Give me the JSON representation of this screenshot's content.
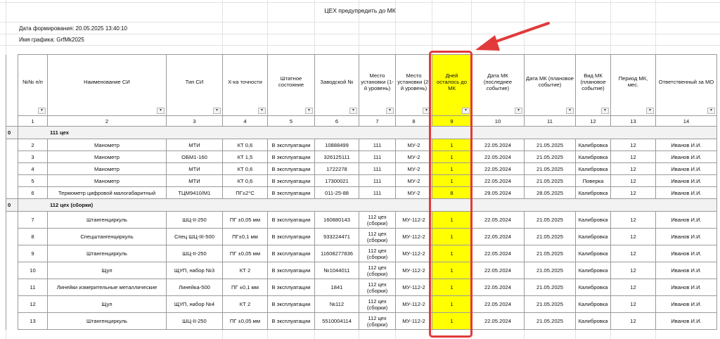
{
  "title": "ЦЕХ предупредить до МК",
  "date_label": "Дата формирования: 20.05.2025 13:40:10",
  "schedule_label": "Имя графика: GrfMk2025",
  "columns": [
    "№№ п/п",
    "Наименование СИ",
    "Тип СИ",
    "Х-ка точности",
    "Штатное состояние",
    "Заводской №",
    "Место установки (1-й уровень)",
    "Место установки (2-й уровень)",
    "Дней осталось до МК",
    "Дата МК (последнее событие)",
    "Дата МК (плановое событие)",
    "Вид МК (плановое событие)",
    "Период МК, мес.",
    "Ответственный за МО"
  ],
  "column_numbers": [
    "1",
    "2",
    "3",
    "4",
    "5",
    "6",
    "7",
    "8",
    "9",
    "10",
    "11",
    "12",
    "13",
    "14"
  ],
  "groups": [
    {
      "level": "0",
      "name": "111 цех",
      "rows": [
        [
          "2",
          "Манометр",
          "МТИ",
          "КТ 0,6",
          "В эксплуатации",
          "10888499",
          "111",
          "МУ-2",
          "1",
          "22.05.2024",
          "21.05.2025",
          "Калибровка",
          "12",
          "Иванов И.И."
        ],
        [
          "3",
          "Манометр",
          "ОБМ1-160",
          "КТ 1,5",
          "В эксплуатации",
          "326125111",
          "111",
          "МУ-2",
          "1",
          "22.05.2024",
          "21.05.2025",
          "Калибровка",
          "12",
          "Иванов И.И."
        ],
        [
          "4",
          "Манометр",
          "МТИ",
          "КТ 0,6",
          "В эксплуатации",
          "1722278",
          "111",
          "МУ-2",
          "1",
          "22.05.2024",
          "21.05.2025",
          "Калибровка",
          "12",
          "Иванов И.И."
        ],
        [
          "5",
          "Манометр",
          "МТИ",
          "КТ 0,6",
          "В эксплуатации",
          "17300021",
          "111",
          "МУ-2",
          "1",
          "22.05.2024",
          "21.05.2025",
          "Поверка",
          "12",
          "Иванов И.И."
        ],
        [
          "6",
          "Термометр цифровой малогабаритный",
          "ТЦМ9410/М1",
          "ПГ±2°С",
          "В эксплуатации",
          "011-25-88",
          "111",
          "МУ-2",
          "8",
          "29.05.2024",
          "28.05.2025",
          "Калибровка",
          "12",
          "Иванов И.И."
        ]
      ]
    },
    {
      "level": "0",
      "name": "112 цех (сборки)",
      "rows": [
        [
          "7",
          "Штангенциркуль",
          "ШЦ-II-250",
          "ПГ ±0,05 мм",
          "В эксплуатации",
          "160880143",
          "112 цех (сборки)",
          "МУ-112-2",
          "1",
          "22.05.2024",
          "21.05.2025",
          "Калибровка",
          "12",
          "Иванов И.И."
        ],
        [
          "8",
          "Спецштангенциркуль",
          "Спец ШЦ-III-500",
          "ПГ±0,1 мм",
          "В эксплуатации",
          "933224471",
          "112 цех (сборки)",
          "МУ-112-2",
          "1",
          "22.05.2024",
          "21.05.2025",
          "Калибровка",
          "12",
          "Иванов И.И."
        ],
        [
          "9",
          "Штангенциркуль",
          "ШЦ-II-250",
          "ПГ ±0,05 мм",
          "В эксплуатации",
          "11608277836",
          "112 цех (сборки)",
          "МУ-112-2",
          "1",
          "22.05.2024",
          "21.05.2025",
          "Калибровка",
          "12",
          "Иванов И.И."
        ],
        [
          "10",
          "Щуп",
          "ЩУП, набор №3",
          "КТ 2",
          "В эксплуатации",
          "№1044011",
          "112 цех (сборки)",
          "МУ-112-2",
          "1",
          "22.05.2024",
          "21.05.2025",
          "Калибровка",
          "12",
          "Иванов И.И."
        ],
        [
          "11",
          "Линейки измерительные металлические",
          "Линейка-500",
          "ПГ ±0,1 мм",
          "В эксплуатации",
          "1841",
          "112 цех (сборки)",
          "МУ-112-2",
          "1",
          "22.05.2024",
          "21.05.2025",
          "Калибровка",
          "12",
          "Иванов И.И."
        ],
        [
          "12",
          "Щуп",
          "ЩУП, набор №4",
          "КТ 2",
          "В эксплуатации",
          "№112",
          "112 цех (сборки)",
          "МУ-112-2",
          "1",
          "22.05.2024",
          "21.05.2025",
          "Калибровка",
          "12",
          "Иванов И.И."
        ],
        [
          "13",
          "Штангенциркуль",
          "ШЦ-II-250",
          "ПГ ±0,05 мм",
          "В эксплуатации",
          "5510004114",
          "112 цех (сборки)",
          "МУ-112-2",
          "1",
          "22.05.2024",
          "21.05.2025",
          "Калибровка",
          "12",
          "Иванов И.И."
        ]
      ]
    }
  ],
  "colors": {
    "highlight_fill": "#ffff00",
    "annotation_red": "#e23a3a"
  },
  "icons": {
    "filter": "dropdown-arrow-icon",
    "annotation": "red-arrow-icon"
  }
}
